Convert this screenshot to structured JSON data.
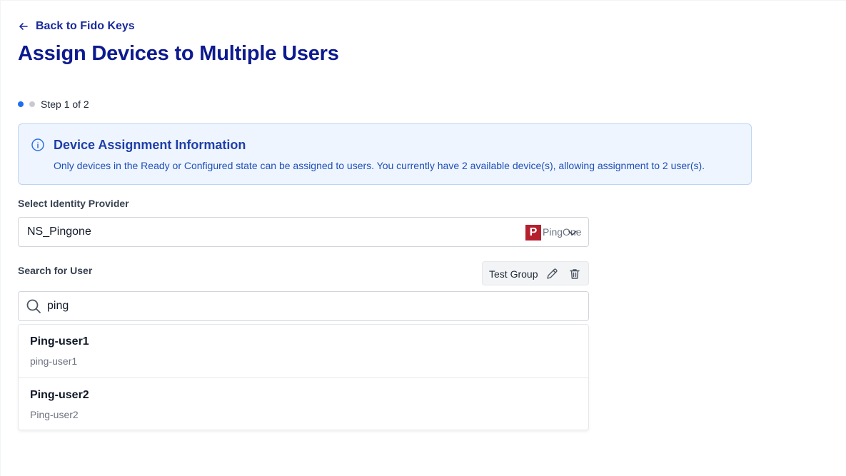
{
  "header": {
    "back_label": "Back to Fido Keys",
    "title": "Assign Devices to Multiple Users"
  },
  "stepper": {
    "label": "Step 1 of 2",
    "current": 1,
    "total": 2
  },
  "info": {
    "title": "Device Assignment Information",
    "text": "Only devices in the Ready or Configured state can be assigned to users. You currently have 2 available device(s), allowing assignment to 2 user(s)."
  },
  "identity_provider": {
    "label": "Select Identity Provider",
    "value": "NS_Pingone",
    "provider_badge": "P",
    "provider_name": "PingOne"
  },
  "search": {
    "label": "Search for User",
    "value": "ping",
    "group_chip": "Test Group"
  },
  "results": [
    {
      "name": "Ping-user1",
      "username": "ping-user1"
    },
    {
      "name": "Ping-user2",
      "username": "Ping-user2"
    }
  ],
  "colors": {
    "primary": "#0d1a8f",
    "accent": "#1e6ff0",
    "info_bg": "#eef5fe",
    "brand_pingone": "#b5202e"
  },
  "icons": {
    "back": "arrow-left-icon",
    "info": "info-circle-icon",
    "dropdown": "chevron-down-icon",
    "edit": "pencil-icon",
    "delete": "trash-icon",
    "search": "search-icon"
  }
}
